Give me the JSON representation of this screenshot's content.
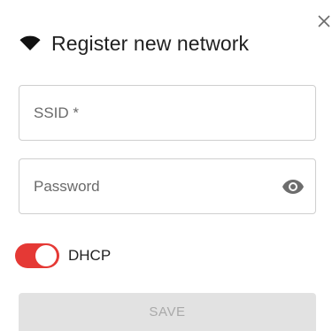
{
  "dialog": {
    "title": "Register new network",
    "close_icon": "close-icon",
    "title_icon": "wifi-icon"
  },
  "form": {
    "ssid": {
      "placeholder": "SSID *",
      "value": ""
    },
    "password": {
      "placeholder": "Password",
      "value": "",
      "visibility_icon": "eye-icon"
    },
    "dhcp": {
      "label": "DHCP",
      "enabled": true,
      "accent_color": "#e53935"
    },
    "save_label": "SAVE"
  }
}
